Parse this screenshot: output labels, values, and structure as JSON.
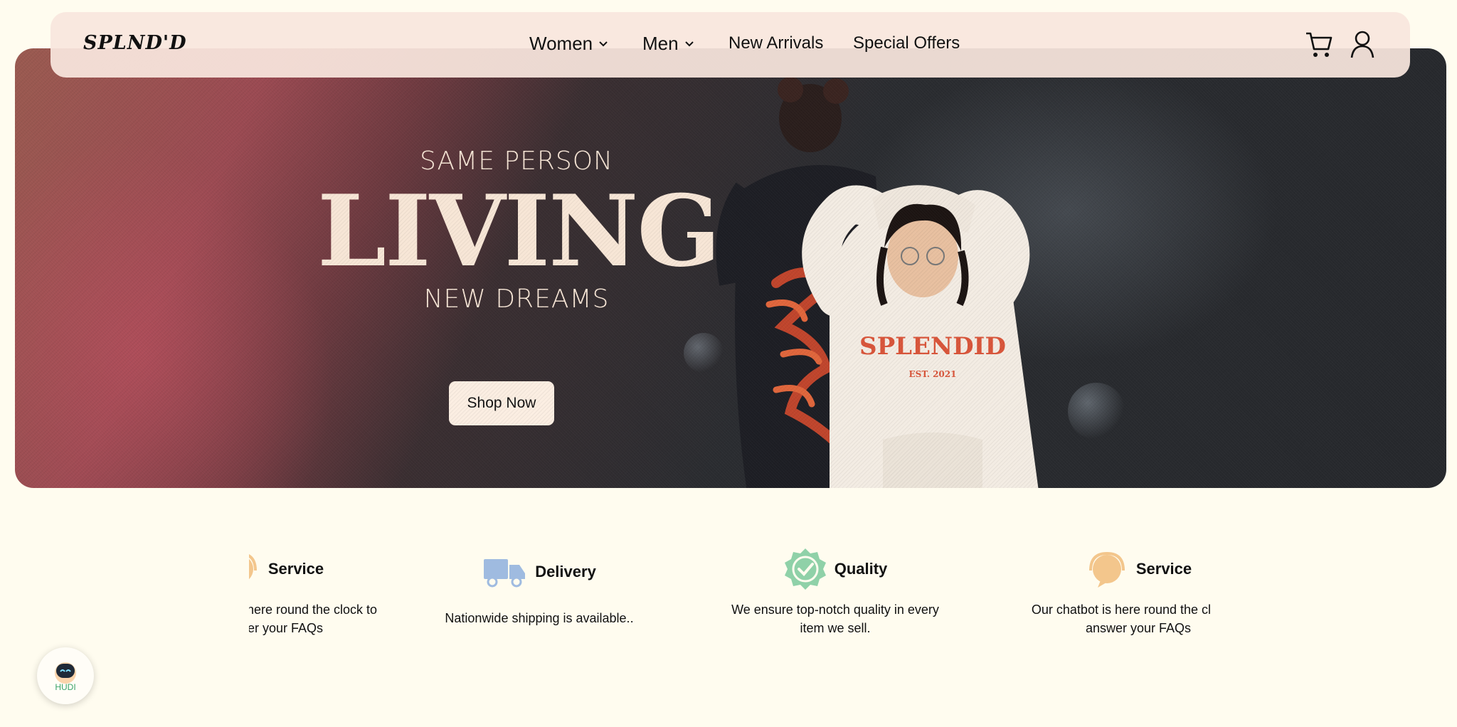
{
  "brand": {
    "logo": "SPLND'D"
  },
  "nav": {
    "items": [
      {
        "label": "Women",
        "has_dropdown": true
      },
      {
        "label": "Men",
        "has_dropdown": true
      },
      {
        "label": "New Arrivals",
        "has_dropdown": false
      },
      {
        "label": "Special Offers",
        "has_dropdown": false
      }
    ],
    "icons": [
      "cart-icon",
      "user-icon"
    ]
  },
  "hero": {
    "line1": "SAME PERSON",
    "line2": "LIVING",
    "line3": "NEW DREAMS",
    "cta": "Shop Now",
    "hoodie_print": "SPLENDID",
    "hoodie_est": "EST. 2021"
  },
  "features": [
    {
      "title": "Service",
      "text_line1": "Our chatbot is here round the clock to",
      "text_line2": "answer your FAQs",
      "icon": "chat-support-icon",
      "partial": true
    },
    {
      "title": "Delivery",
      "text_line1": "Nationwide shipping is available..",
      "text_line2": "",
      "icon": "truck-icon"
    },
    {
      "title": "Quality",
      "text_line1": "We ensure top-notch quality in every",
      "text_line2": "item we sell.",
      "icon": "verified-badge-icon"
    },
    {
      "title": "Service",
      "text_line1": "Our chatbot is here round the clock to",
      "text_line2": "answer your FAQs",
      "icon": "chat-support-icon",
      "partial": true
    }
  ],
  "chatbot": {
    "label": "HUDI"
  },
  "colors": {
    "page_bg": "#fffcef",
    "nav_bg": "#f9e6de",
    "hero_text": "#f7e6d6",
    "quality_green": "#8fd1a8",
    "delivery_blue": "#9fbbe0",
    "service_orange": "#f3c68c"
  }
}
